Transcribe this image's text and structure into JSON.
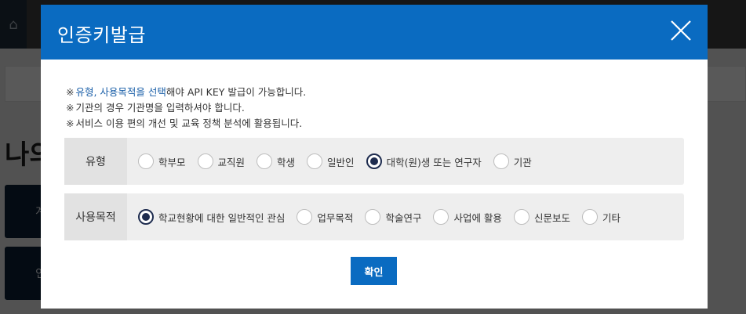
{
  "background": {
    "heading_fragment": "나의",
    "card1_fragment": "계",
    "card2_fragment": "인"
  },
  "modal": {
    "title": "인증키발급",
    "notes": {
      "line1_mark": "※",
      "line1_highlight": "유형, 사용목적을 선택",
      "line1_rest": "해야 API KEY 발급이 가능합니다.",
      "line2_mark": "※",
      "line2_text": "기관의 경우 기관명을 입력하셔야 합니다.",
      "line3_mark": "※",
      "line3_text": "서비스 이용 편의 개선 및 교육 정책 분석에 활용됩니다."
    },
    "type_row": {
      "label": "유형",
      "options": [
        "학부모",
        "교직원",
        "학생",
        "일반인",
        "대학(원)생 또는 연구자",
        "기관"
      ],
      "selected": "대학(원)생 또는 연구자"
    },
    "purpose_row": {
      "label": "사용목적",
      "options": [
        "학교현황에 대한 일반적인 관심",
        "업무목적",
        "학술연구",
        "사업에 활용",
        "신문보도",
        "기타"
      ],
      "selected": "학교현황에 대한 일반적인 관심"
    },
    "confirm_label": "확인"
  },
  "colors": {
    "header": "#0a6bc1",
    "radio_checked": "#1e2c4f",
    "highlight_text": "#1a5fa8"
  }
}
